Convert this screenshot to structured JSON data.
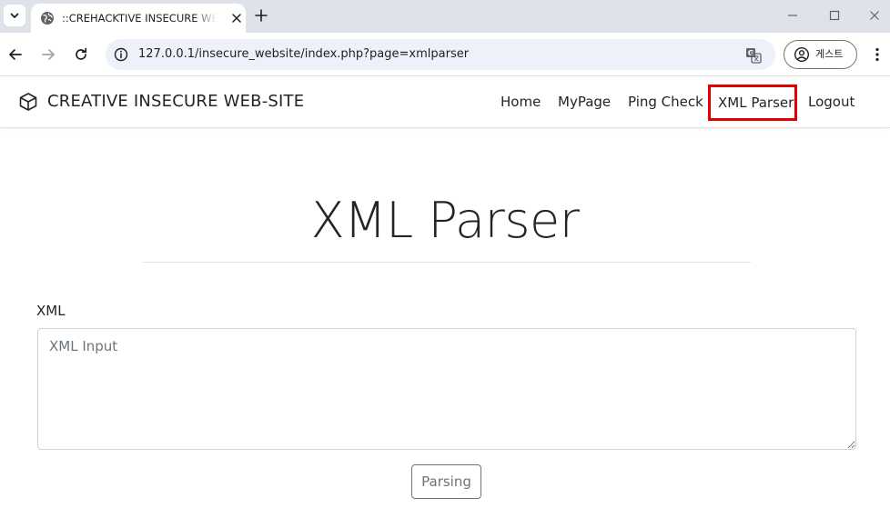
{
  "browser": {
    "tab_title": "::CREHACKTIVE INSECURE WEB",
    "url": "127.0.0.1/insecure_website/index.php?page=xmlparser",
    "profile_label": "게스트"
  },
  "site": {
    "brand": "CREATIVE INSECURE WEB-SITE",
    "nav": {
      "home": "Home",
      "mypage": "MyPage",
      "ping_check": "Ping Check",
      "xml_parser": "XML Parser",
      "logout": "Logout"
    }
  },
  "main": {
    "title": "XML Parser",
    "field_label": "XML",
    "input_placeholder": "XML Input",
    "input_value": "",
    "submit_label": "Parsing"
  },
  "colors": {
    "highlight": "#e00000",
    "text": "#212529",
    "muted": "#6c757d"
  }
}
